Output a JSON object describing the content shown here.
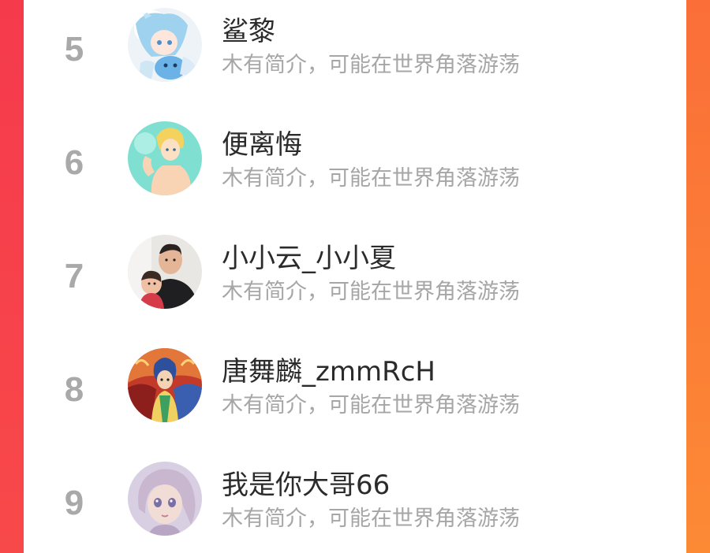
{
  "users": [
    {
      "rank": "5",
      "name": "鲨黎",
      "bio": "木有简介，可能在世界角落游荡",
      "avatar": "anime-girl-avatar"
    },
    {
      "rank": "6",
      "name": "便离悔",
      "bio": "木有简介，可能在世界角落游荡",
      "avatar": "anime-boy-avatar"
    },
    {
      "rank": "7",
      "name": "小小云_小小夏",
      "bio": "木有简介，可能在世界角落游荡",
      "avatar": "father-child-photo-avatar"
    },
    {
      "rank": "8",
      "name": "唐舞麟_zmmRcH",
      "bio": "木有简介，可能在世界角落游荡",
      "avatar": "anime-warrior-avatar"
    },
    {
      "rank": "9",
      "name": "我是你大哥66",
      "bio": "木有简介，可能在世界角落游荡",
      "avatar": "doll-avatar"
    }
  ],
  "colors": {
    "rank": "#a9a9a9",
    "name": "#2b2b2b",
    "bio": "#a6a6a6",
    "frame_left": "#f8384a",
    "frame_right": "#fb7a36"
  }
}
